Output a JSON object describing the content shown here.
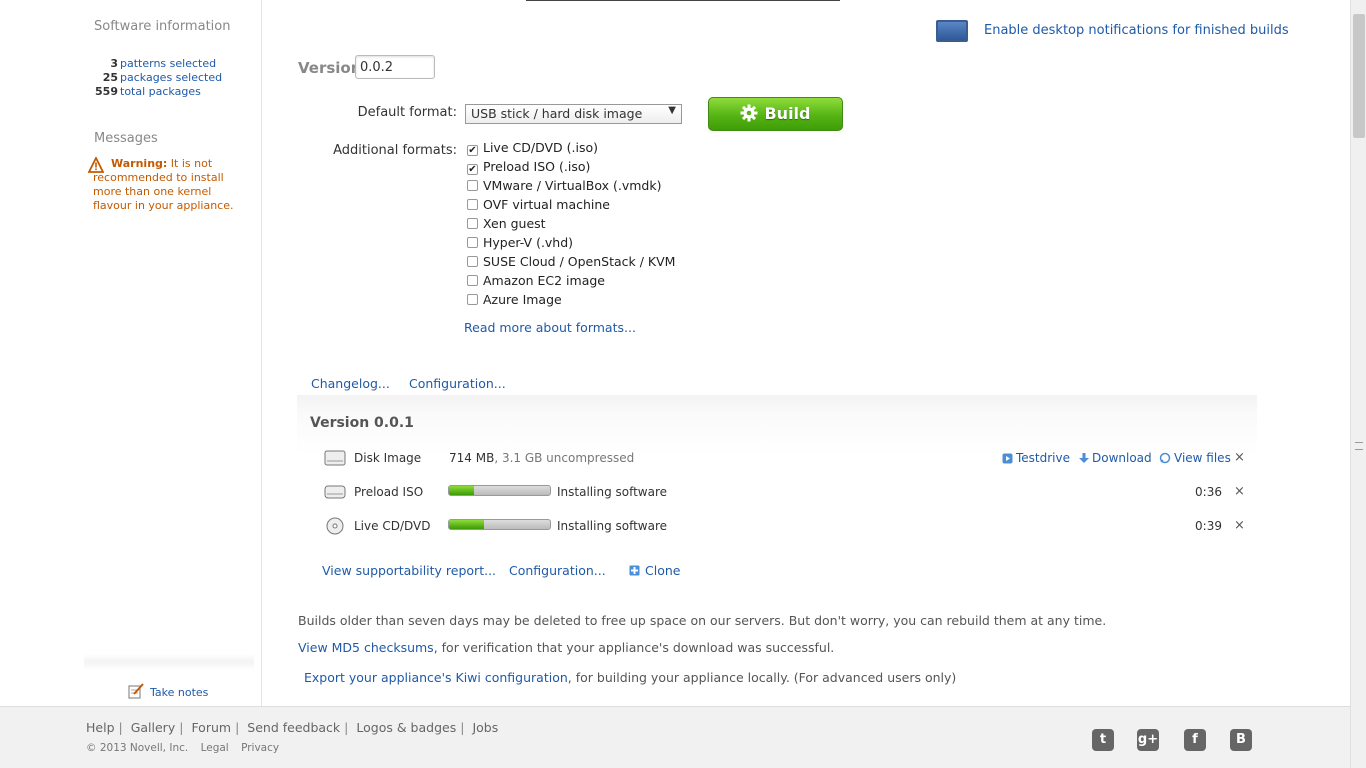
{
  "sidebar": {
    "software_title": "Software information",
    "stats": [
      {
        "count": "3",
        "label": "patterns selected"
      },
      {
        "count": "25",
        "label": "packages selected"
      },
      {
        "count": "559",
        "label": "total packages"
      }
    ],
    "messages_title": "Messages",
    "warning": {
      "prefix": "Warning:",
      "text": "It is not recommended to install more than one kernel flavour in your appliance.",
      "icon": "warning-triangle-icon"
    },
    "take_notes": "Take notes"
  },
  "notify": {
    "label": "Enable desktop notifications for finished builds",
    "icon": "monitor-icon"
  },
  "build_form": {
    "version_label": "Version",
    "version_value": "0.0.2",
    "default_format_label": "Default format:",
    "default_format_value": "USB stick / hard disk image",
    "build_label": "Build",
    "additional_formats_label": "Additional formats:",
    "formats": [
      {
        "label": "Live CD/DVD (.iso)",
        "checked": true
      },
      {
        "label": "Preload ISO (.iso)",
        "checked": true
      },
      {
        "label": "VMware / VirtualBox (.vmdk)",
        "checked": false
      },
      {
        "label": "OVF virtual machine",
        "checked": false
      },
      {
        "label": "Xen guest",
        "checked": false
      },
      {
        "label": "Hyper-V (.vhd)",
        "checked": false
      },
      {
        "label": "SUSE Cloud / OpenStack / KVM",
        "checked": false
      },
      {
        "label": "Amazon EC2 image",
        "checked": false
      },
      {
        "label": "Azure Image",
        "checked": false
      }
    ],
    "read_more": "Read more about formats..."
  },
  "tabs": {
    "changelog": "Changelog...",
    "configuration": "Configuration..."
  },
  "builds": {
    "title": "Version 0.0.1",
    "disk_image": {
      "name": "Disk Image",
      "size": "714 MB",
      "uncompressed": ", 3.1 GB uncompressed",
      "testdrive": "Testdrive",
      "download": "Download",
      "view_files": "View files",
      "close": "×"
    },
    "preload_iso": {
      "name": "Preload ISO",
      "progress": 0.25,
      "status": "Installing software",
      "time": "0:36",
      "close": "×"
    },
    "live_cd": {
      "name": "Live CD/DVD",
      "progress": 0.35,
      "status": "Installing software",
      "time": "0:39",
      "close": "×"
    },
    "supportability": "View supportability report...",
    "configuration": "Configuration...",
    "clone": "Clone"
  },
  "info": {
    "retention": "Builds older than seven days may be deleted to free up space on our servers. But don't worry, you can rebuild them at any time.",
    "md5_link": "View MD5 checksums",
    "md5_rest": ", for verification that your appliance's download was successful.",
    "kiwi_link": "Export your appliance's Kiwi configuration",
    "kiwi_rest": ", for building your appliance locally. (For advanced users only)"
  },
  "footer": {
    "links": [
      "Help",
      "Gallery",
      "Forum",
      "Send feedback",
      "Logos & badges",
      "Jobs"
    ],
    "copyright": "© 2013 Novell, Inc.",
    "legal": "Legal",
    "privacy": "Privacy",
    "social": [
      {
        "icon": "twitter-icon",
        "glyph": "t"
      },
      {
        "icon": "google-plus-icon",
        "glyph": "g+"
      },
      {
        "icon": "facebook-icon",
        "glyph": "f"
      },
      {
        "icon": "blogger-icon",
        "glyph": "B"
      }
    ]
  },
  "colors": {
    "accent": "#1f5aa8",
    "warning": "#c35a00",
    "build_green": "#55b414"
  }
}
